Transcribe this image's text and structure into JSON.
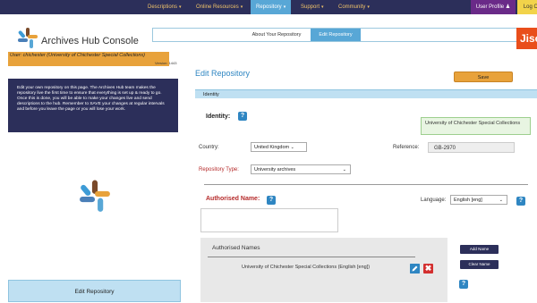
{
  "nav": {
    "items": [
      {
        "label": "Descriptions",
        "caret": "▾"
      },
      {
        "label": "Online Resources",
        "caret": "▾"
      },
      {
        "label": "Repository",
        "caret": "▾"
      },
      {
        "label": "Support",
        "caret": "▾"
      },
      {
        "label": "Community",
        "caret": "▾"
      }
    ],
    "profile": "User Profile ♟",
    "logout": "Log O"
  },
  "brand": {
    "title": "Archives Hub Console",
    "jisc": "Jisc",
    "logo_icon": "archives-hub-star-icon"
  },
  "tabs": {
    "about": "About Your Repository",
    "edit": "Edit Repository"
  },
  "user": {
    "line": "User: chichester (University of Chichester Special Collections)",
    "version": "Version: 1443"
  },
  "info": "Edit your own repository on this page. The Archives Hub team makes the repository live the first time to ensure that everything is set up & ready to go. Once this is done, you will be able to make your changes live and send descriptions to the hub. Remember to SAVE your changes at regular intervals and before you leave the page or you will lose your work.",
  "sidebar": {
    "edit_repository": "Edit Repository"
  },
  "main": {
    "title": "Edit Repository",
    "save": "Save",
    "section": "Identity",
    "identity_label": "Identity:",
    "repo_name": "University of Chichester Special Collections",
    "country_label": "Country:",
    "country_value": "United Kingdom",
    "reference_label": "Reference:",
    "reference_value": "GB-2970",
    "repo_type_label": "Repository Type:",
    "repo_type_value": "University archives",
    "authorised_name_label": "Authorised Name:",
    "language_label": "Language:",
    "language_value": "English [eng]",
    "authorised_names_header": "Authorised Names",
    "authorised_name_entry": "University of Chichester Special Collections (English [eng])",
    "add_name": "Add Name",
    "clear_name": "Clear Name",
    "help_glyph": "?",
    "delete_glyph": "✖"
  }
}
